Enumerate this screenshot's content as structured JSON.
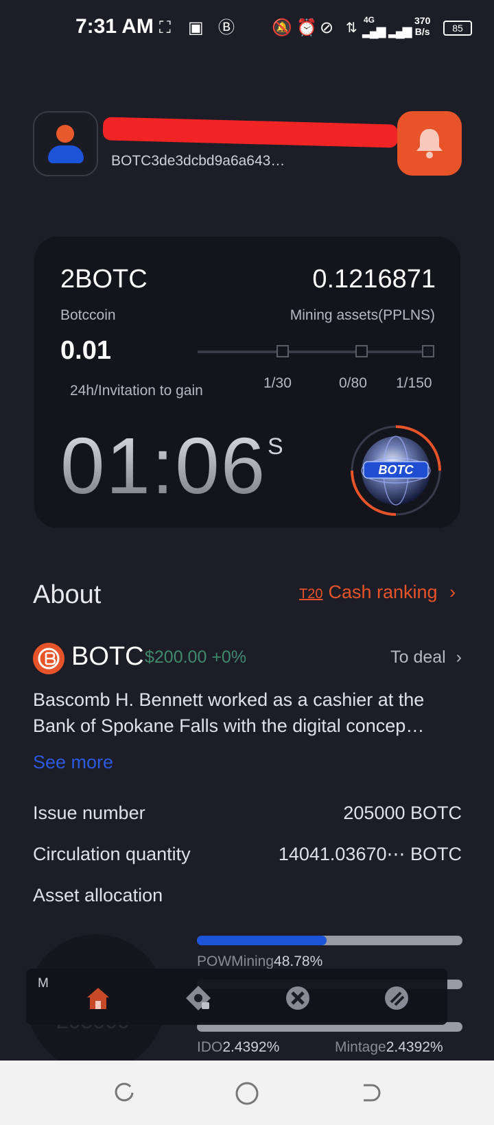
{
  "status_bar": {
    "time": "7:31 AM",
    "network": "4G",
    "speed_value": "370",
    "speed_unit": "B/s",
    "battery": "85"
  },
  "header": {
    "wallet_address": "BOTC3de3dcbd9a6a643…"
  },
  "mining_card": {
    "coin_amount": "2BOTC",
    "coin_name": "Botccoin",
    "mining_value": "0.1216871",
    "mining_label": "Mining assets(PPLNS)",
    "rate": "0.01",
    "rate_label": "24h/Invitation to gain",
    "progress": [
      "1/30",
      "0/80",
      "1/150"
    ],
    "timer": "01:06",
    "timer_unit": "S",
    "globe_label": "BOTC"
  },
  "about": {
    "title": "About",
    "ranking_tag": "T20",
    "ranking_link": "Cash ranking",
    "coin_symbol": "BOTC",
    "coin_price": "$200.00 +0%",
    "deal_link": "To deal",
    "description": "Bascomb H. Bennett worked as a cashier at the Bank of Spokane Falls with the digital concep…",
    "see_more": "See more",
    "issue_label": "Issue number",
    "issue_value": "205000 BOTC",
    "circulation_label": "Circulation quantity",
    "circulation_value": "14041.03670⋯ BOTC",
    "allocation_label": "Asset allocation"
  },
  "allocation": [
    {
      "name": "POWMining",
      "pct": "48.78%",
      "fraction": 0.4878
    },
    {
      "name": "IDO",
      "pct": "2.4392%",
      "fraction": 0.024392
    },
    {
      "name": "Mintage",
      "pct": "2.4392%",
      "fraction": 0.024392
    }
  ],
  "donut": {
    "label": "M",
    "total": "205000"
  },
  "bottom_nav": [
    {
      "icon": "home-icon",
      "active": true
    },
    {
      "icon": "vault-icon",
      "active": false
    },
    {
      "icon": "exchange-icon",
      "active": false
    },
    {
      "icon": "wallet-icon",
      "active": false
    }
  ],
  "colors": {
    "accent": "#e8542a",
    "blue": "#1b54d8",
    "background": "#1c1d26"
  }
}
